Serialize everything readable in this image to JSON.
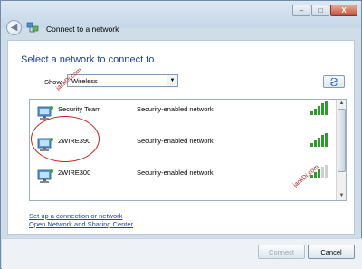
{
  "window": {
    "title": "Connect to a network",
    "caption_buttons": {
      "minimize": "–",
      "maximize": "□",
      "close": "X"
    }
  },
  "heading": "Select a network to connect to",
  "filter": {
    "label": "Show",
    "selected": "Wireless"
  },
  "networks": [
    {
      "ssid": "Security Team",
      "security": "Security-enabled network",
      "signal_bars": 5
    },
    {
      "ssid": "2WIRE390",
      "security": "Security-enabled network",
      "signal_bars": 5
    },
    {
      "ssid": "2WIRE300",
      "security": "Security-enabled network",
      "signal_bars": 3
    }
  ],
  "watermarks": [
    "jackDi.com",
    "jackDi.com"
  ],
  "links": {
    "setup": "Set up a connection or network",
    "sharing_center": "Open Network and Sharing Center"
  },
  "buttons": {
    "connect": "Connect",
    "cancel": "Cancel"
  },
  "icons": {
    "back": "back-arrow-icon",
    "refresh": "refresh-icon",
    "network": "wireless-network-icon"
  },
  "colors": {
    "heading": "#1e3f8f",
    "link": "#2046a8",
    "annotation": "#c91f1f",
    "signal": "#2f9a2f"
  }
}
